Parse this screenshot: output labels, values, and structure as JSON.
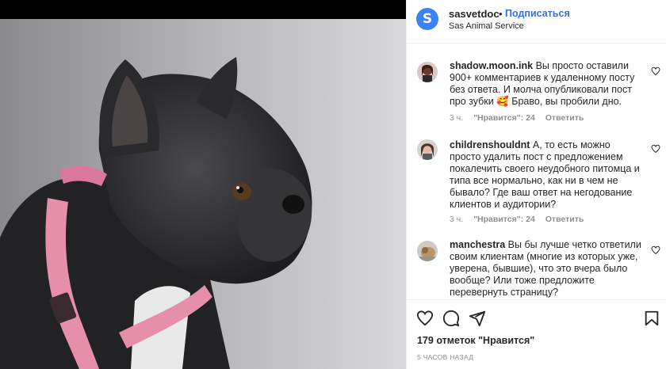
{
  "post": {
    "image_alt": "French bulldog with pink harness",
    "header": {
      "avatar_letter": "S",
      "username": "sasvetdoc",
      "dot": "•",
      "follow_label": "Подписаться",
      "subtitle": "Sas Animal Service"
    },
    "comments": [
      {
        "username": "shadow.moon.ink",
        "text": "Вы просто оставили 900+ комментариев к удаленному посту без ответа. И молча опубликовали пост про зубки 🥰 Браво, вы пробили дно.",
        "time": "3 ч.",
        "likes": "\"Нравится\": 24",
        "reply": "Ответить"
      },
      {
        "username": "childrenshouldnt",
        "text": "А, то есть можно просто удалить пост с предложением покалечить своего неудобного питомца и типа все нормально, как ни в чем не бывало? Где ваш ответ на негодование клиентов и аудитории?",
        "time": "3 ч.",
        "likes": "\"Нравится\": 24",
        "reply": "Ответить"
      },
      {
        "username": "manchestra",
        "text": "Вы бы лучше четко ответили своим клиентам (многие из которых уже, уверена, бывшие), что это вчера было вообще? Или тоже предложите перевернуть страницу?"
      }
    ],
    "likes_count": "179 отметок \"Нравится\"",
    "posted_ago": "5 ЧАСОВ НАЗАД"
  },
  "colors": {
    "accent": "#3b6fd8",
    "avatar_bg": "#3b82f6",
    "muted": "#8e8e8e"
  },
  "icons": [
    "heart-icon",
    "comment-icon",
    "share-icon",
    "bookmark-icon"
  ]
}
